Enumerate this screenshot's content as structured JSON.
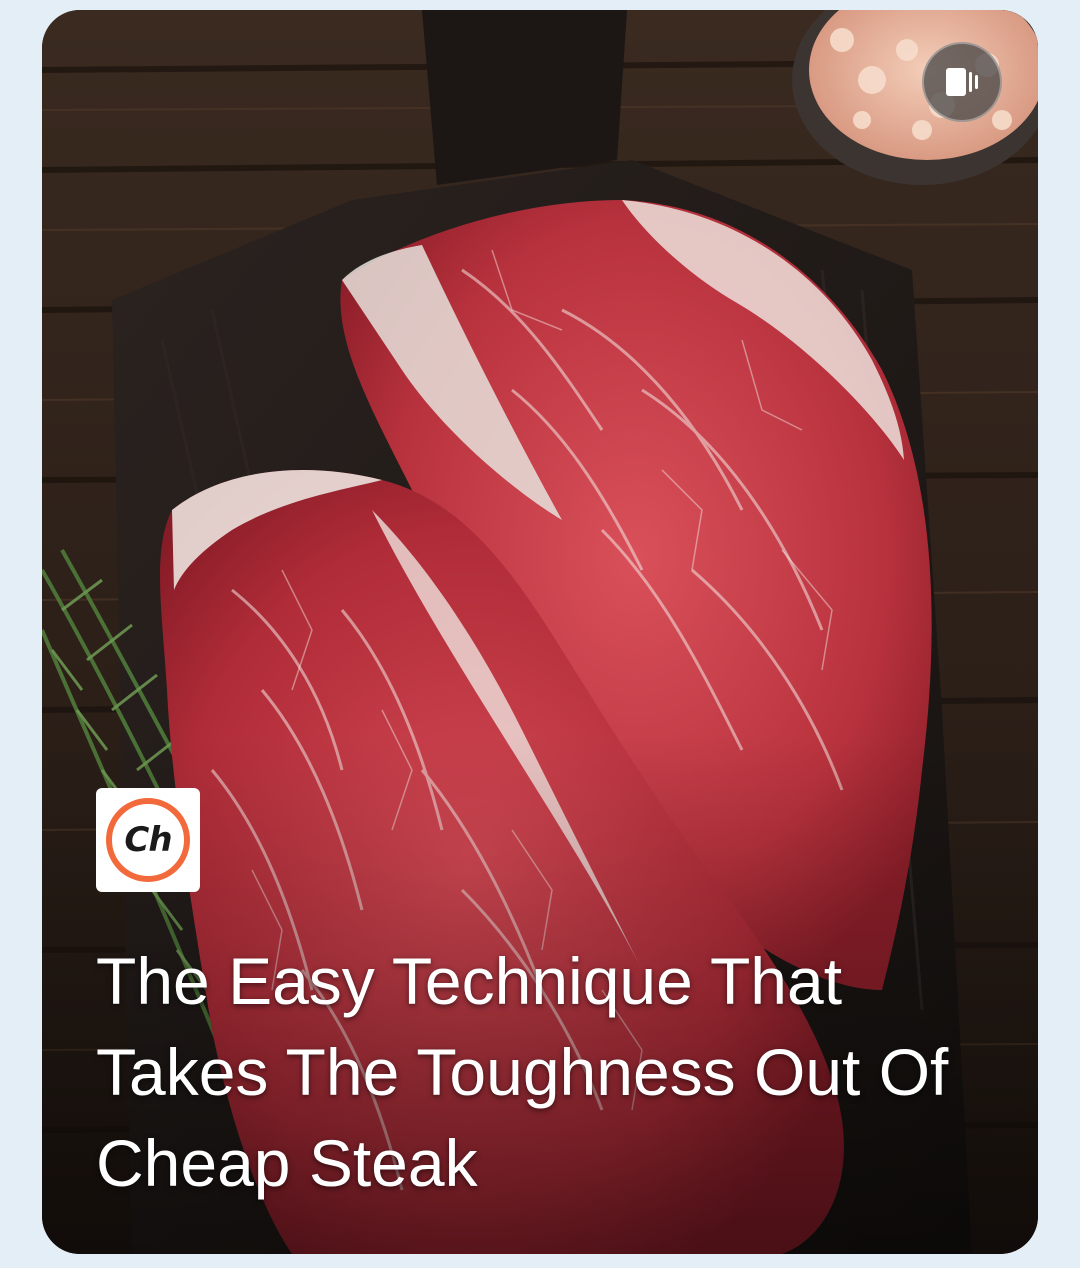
{
  "card": {
    "headline": "The Easy Technique That Takes The Toughness Out Of Cheap Steak",
    "publisher_logo_text": "Ch",
    "image_description_icon": "steak-photo",
    "story_button_icon": "story-stack-icon"
  },
  "colors": {
    "page_background": "#e4eef7",
    "headline_text": "#ffffff",
    "logo_ring": "#f26a3b"
  }
}
